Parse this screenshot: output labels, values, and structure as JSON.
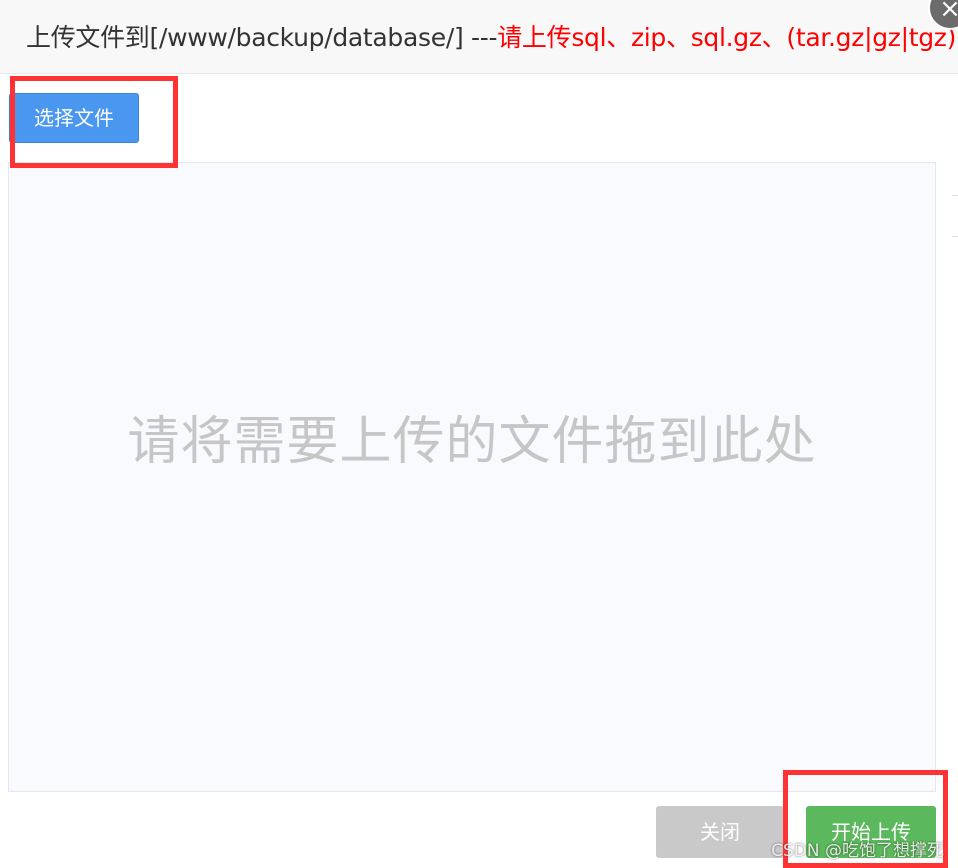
{
  "dialog": {
    "title_prefix": "上传文件到[/www/backup/database/] ---",
    "title_hint": "请上传sql、zip、sql.gz、(tar.gz|gz|tgz)",
    "close_icon": "×"
  },
  "toolbar": {
    "select_file_label": "选择文件"
  },
  "drop_zone": {
    "hint": "请将需要上传的文件拖到此处"
  },
  "footer": {
    "close_label": "关闭",
    "start_upload_label": "开始上传"
  },
  "watermark": "CSDN @吃饱了想撑死",
  "colors": {
    "primary": "#4a97f0",
    "success": "#5cb85c",
    "disabled": "#c9c9c9",
    "hint_red": "#ff0000",
    "annotation_red": "#ff3333"
  }
}
